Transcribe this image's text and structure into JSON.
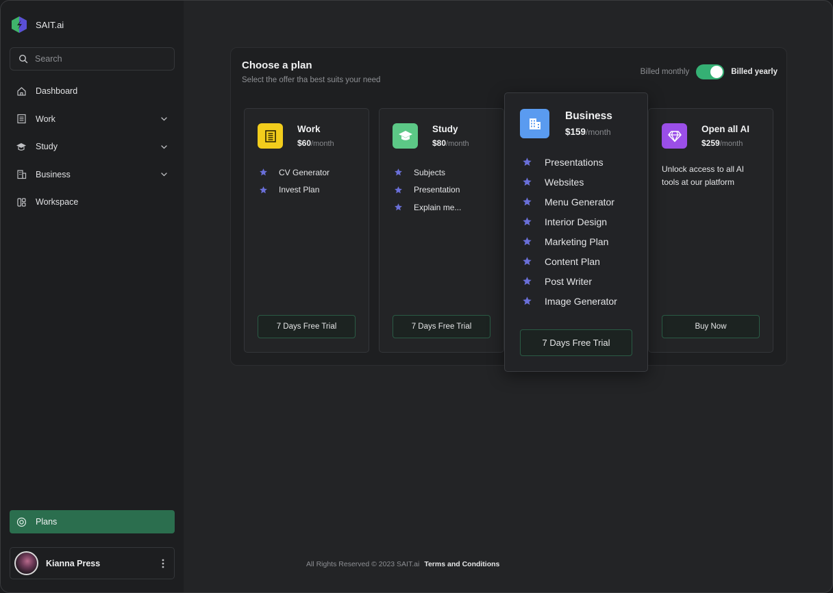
{
  "brand": {
    "name": "SAIT.ai",
    "logo_colors": [
      "#3fb36b",
      "#5a4fd6"
    ]
  },
  "search": {
    "placeholder": "Search",
    "icon": "search-icon"
  },
  "sidebar": {
    "items": [
      {
        "label": "Dashboard",
        "icon": "home-icon",
        "expandable": false
      },
      {
        "label": "Work",
        "icon": "document-icon",
        "expandable": true
      },
      {
        "label": "Study",
        "icon": "graduation-cap-icon",
        "expandable": true
      },
      {
        "label": "Business",
        "icon": "building-icon",
        "expandable": true
      },
      {
        "label": "Workspace",
        "icon": "layout-icon",
        "expandable": false
      }
    ],
    "plans_label": "Plans",
    "plans_icon": "target-icon",
    "user": {
      "name": "Kianna Press"
    }
  },
  "main": {
    "title": "Choose a plan",
    "subtitle": "Select the offer tha best suits your need",
    "billing": {
      "monthly_label": "Billed monthly",
      "yearly_label": "Billed yearly",
      "yearly_selected": true
    }
  },
  "plans": [
    {
      "name": "Work",
      "price": "$60",
      "period": "/month",
      "icon": "document-icon",
      "color": "#f2cd1c",
      "features": [
        "CV Generator",
        "Invest Plan"
      ],
      "button": "7 Days Free Trial"
    },
    {
      "name": "Study",
      "price": "$80",
      "period": "/month",
      "icon": "graduation-cap-icon",
      "color": "#5cc886",
      "features": [
        "Subjects",
        "Presentation",
        "Explain me..."
      ],
      "button": "7 Days Free Trial"
    },
    {
      "name": "Business",
      "price": "$159",
      "period": "/month",
      "icon": "building-icon",
      "color": "#5a9bf0",
      "features": [
        "Presentations",
        "Websites",
        "Menu Generator",
        "Interior Design",
        "Marketing Plan",
        "Content Plan",
        "Post Writer",
        "Image Generator"
      ],
      "button": "7 Days Free Trial",
      "highlighted": true
    },
    {
      "name": "Open all AI",
      "price": "$259",
      "period": "/month",
      "icon": "diamond-icon",
      "color": "#9b4fe8",
      "description": "Unlock access to all AI tools at our platform",
      "button": "Buy Now"
    }
  ],
  "footer": {
    "copyright": "All Rights Reserved © 2023 SAIT.ai",
    "terms": "Terms and Conditions"
  },
  "accent_colors": {
    "green": "#35b074",
    "plans_bg": "#2b6e4e",
    "star": "#6a6fd8"
  }
}
